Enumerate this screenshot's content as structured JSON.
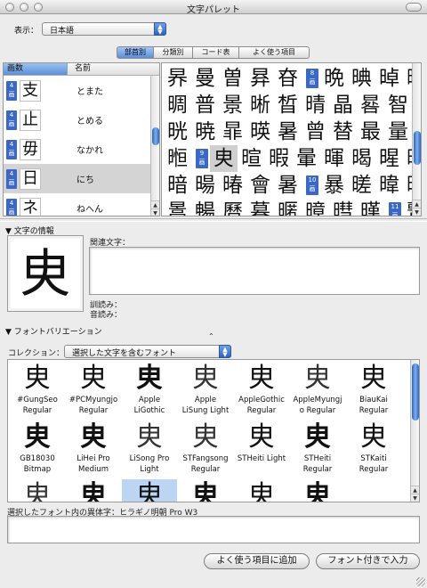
{
  "window": {
    "title": "文字パレット"
  },
  "display": {
    "label": "表示：",
    "value": "日本語"
  },
  "tabs": [
    {
      "label": "部首別",
      "active": true
    },
    {
      "label": "分類別",
      "active": false
    },
    {
      "label": "コード表",
      "active": false
    },
    {
      "label": "よく使う項目",
      "active": false
    }
  ],
  "radical_list": {
    "headers": {
      "strokes": "画数",
      "name": "名前"
    },
    "rows": [
      {
        "strokes": "4",
        "unit": "画",
        "glyph": "支",
        "name": "とまた",
        "selected": false
      },
      {
        "strokes": "4",
        "unit": "画",
        "glyph": "止",
        "name": "とめる",
        "selected": false
      },
      {
        "strokes": "4",
        "unit": "画",
        "glyph": "毋",
        "name": "なかれ",
        "selected": false
      },
      {
        "strokes": "4",
        "unit": "画",
        "glyph": "日",
        "name": "にち",
        "selected": true
      },
      {
        "strokes": "4",
        "unit": "画",
        "glyph": "ネ",
        "name": "ねへん",
        "selected": false
      }
    ]
  },
  "kanji_grid": {
    "rows": [
      [
        "昦",
        "曼",
        "曽",
        "昪",
        "昚",
        {
          "badge": "8",
          "unit": "画"
        },
        "晩",
        "晪",
        "晫",
        "晬"
      ],
      [
        "晭",
        "普",
        "景",
        "晰",
        "晳",
        "晴",
        "晶",
        "晷",
        "智",
        "晻"
      ],
      [
        "晄",
        "暁",
        "暃",
        "暎",
        "暑",
        "曾",
        "替",
        "最",
        "量",
        "暆"
      ],
      [
        "暅",
        {
          "badge": "9",
          "unit": "画"
        },
        "㬰",
        "暄",
        "暇",
        "暈",
        "暉",
        "暍",
        "暒",
        "暖"
      ],
      [
        "暗",
        "暘",
        "暙",
        "會",
        "暑",
        {
          "badge": "10",
          "unit": "画"
        },
        "暴",
        "暛",
        "暐",
        "暝"
      ],
      [
        "暠",
        "暢",
        "曆",
        "暮",
        "暱",
        "暲",
        "暳",
        "暵",
        {
          "badge": "11",
          "unit": "画"
        },
        "暫"
      ]
    ],
    "selected_char": "㬰"
  },
  "char_info": {
    "section_label": "文字の情報",
    "big_char": "㬰",
    "related_label": "関連文字：",
    "kun_label": "訓読み：",
    "on_label": "音読み："
  },
  "font_variation": {
    "section_label": "フォントバリエーション",
    "collection_label": "コレクション：",
    "collection_value": "選択した文字を含むフォント",
    "glyph": "㬰",
    "fonts": [
      {
        "line1": "#GungSeo",
        "line2": "Regular",
        "selected": false,
        "style": "serif"
      },
      {
        "line1": "#PCMyungjo",
        "line2": "Regular",
        "selected": false,
        "style": "serif"
      },
      {
        "line1": "Apple",
        "line2": "LiGothic",
        "selected": false,
        "style": "bold"
      },
      {
        "line1": "Apple",
        "line2": "LiSung Light",
        "selected": false,
        "style": "light"
      },
      {
        "line1": "AppleGothic",
        "line2": "Regular",
        "selected": false,
        "style": "sans"
      },
      {
        "line1": "AppleMyungj",
        "line2": "o Regular",
        "selected": false,
        "style": "light"
      },
      {
        "line1": "BiauKai",
        "line2": "Regular",
        "selected": false,
        "style": "serif"
      },
      {
        "line1": "GB18030",
        "line2": "Bitmap",
        "selected": false,
        "style": "bitmap"
      },
      {
        "line1": "LiHei Pro",
        "line2": "Medium",
        "selected": false,
        "style": "bold"
      },
      {
        "line1": "LiSong Pro",
        "line2": "Light",
        "selected": false,
        "style": "light"
      },
      {
        "line1": "STFangsong",
        "line2": "Regular",
        "selected": false,
        "style": "light"
      },
      {
        "line1": "STHeiti Light",
        "line2": "",
        "selected": false,
        "style": "sans"
      },
      {
        "line1": "STHeiti",
        "line2": "Regular",
        "selected": false,
        "style": "bold"
      },
      {
        "line1": "STKaiti",
        "line2": "Regular",
        "selected": false,
        "style": "serif"
      },
      {
        "line1": "",
        "line2": "",
        "selected": false,
        "style": "light"
      },
      {
        "line1": "",
        "line2": "",
        "selected": false,
        "style": "bold"
      },
      {
        "line1": "",
        "line2": "",
        "selected": true,
        "style": "serif"
      },
      {
        "line1": "",
        "line2": "",
        "selected": false,
        "style": "bold"
      },
      {
        "line1": "",
        "line2": "",
        "selected": false,
        "style": "sans"
      },
      {
        "line1": "",
        "line2": "",
        "selected": false,
        "style": "bold"
      }
    ],
    "variant_label": "選択したフォント内の異体字：ヒラギノ明朝 Pro W3"
  },
  "buttons": {
    "add_favorite": "よく使う項目に追加",
    "insert_with_font": "フォント付きで入力"
  },
  "colors": {
    "accent": "#3a68c4",
    "selection": "#cfcfcf",
    "font_selection": "#bcd5f3"
  }
}
